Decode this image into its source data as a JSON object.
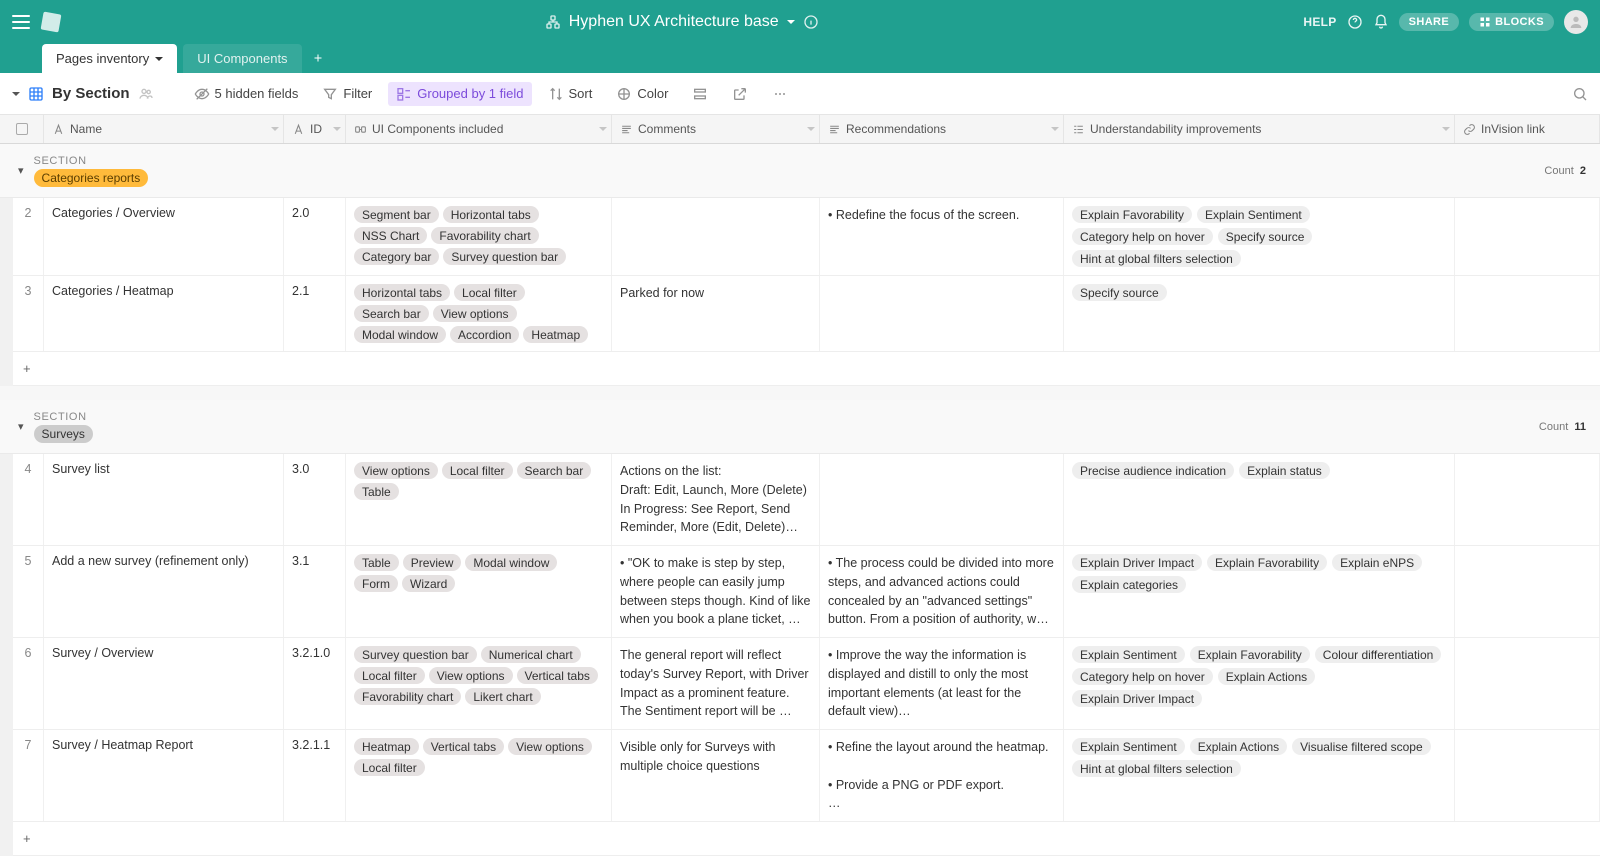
{
  "header": {
    "title": "Hyphen UX Architecture base",
    "help": "HELP",
    "share": "SHARE",
    "blocks": "BLOCKS"
  },
  "tabs": [
    {
      "label": "Pages inventory",
      "active": true
    },
    {
      "label": "UI Components",
      "active": false
    }
  ],
  "view": {
    "name": "By Section",
    "hidden_fields": "5 hidden fields",
    "filter": "Filter",
    "grouped": "Grouped by 1 field",
    "sort": "Sort",
    "color": "Color"
  },
  "columns": {
    "name": "Name",
    "id": "ID",
    "ui_components": "UI Components included",
    "comments": "Comments",
    "recommendations": "Recommendations",
    "understandability": "Understandability improvements",
    "invision": "InVision link"
  },
  "groups": [
    {
      "section_label": "SECTION",
      "name": "Categories reports",
      "pill_class": "pill-orange",
      "count_label": "Count",
      "count": "2",
      "rows": [
        {
          "num": "2",
          "name": "Categories / Overview",
          "id": "2.0",
          "components": [
            "Segment bar",
            "Horizontal tabs",
            "NSS Chart",
            "Favorability chart",
            "Category bar",
            "Survey question bar"
          ],
          "comments": "",
          "recs": "• Redefine the focus of the screen.",
          "und": [
            "Explain Favorability",
            "Explain Sentiment",
            "Category help on hover",
            "Specify source",
            "Hint at global filters selection"
          ]
        },
        {
          "num": "3",
          "name": "Categories / Heatmap",
          "id": "2.1",
          "components": [
            "Horizontal tabs",
            "Local filter",
            "Search bar",
            "View options",
            "Modal window",
            "Accordion",
            "Heatmap"
          ],
          "comments": "Parked for now",
          "recs": "",
          "und": [
            "Specify source"
          ]
        }
      ]
    },
    {
      "section_label": "SECTION",
      "name": "Surveys",
      "pill_class": "pill-gray",
      "count_label": "Count",
      "count": "11",
      "rows": [
        {
          "num": "4",
          "name": "Survey list",
          "id": "3.0",
          "components": [
            "View options",
            "Local filter",
            "Search bar",
            "Table"
          ],
          "comments": "Actions on the list:\nDraft: Edit, Launch, More (Delete)\nIn Progress: See Report, Send Reminder, More (Edit, Delete)…",
          "recs": "",
          "und": [
            "Precise audience indication",
            "Explain status"
          ]
        },
        {
          "num": "5",
          "name": "Add a new survey (refinement only)",
          "id": "3.1",
          "components": [
            "Table",
            "Preview",
            "Modal window",
            "Form",
            "Wizard"
          ],
          "comments": "• \"OK to make is step by step, where people can easily jump between steps though. Kind of like when you book a plane ticket, …",
          "recs": "• The process could be divided into more steps, and advanced actions could concealed by an \"advanced settings\" button. From a position of authority, w…",
          "und": [
            "Explain Driver Impact",
            "Explain Favorability",
            "Explain eNPS",
            "Explain categories"
          ]
        },
        {
          "num": "6",
          "name": "Survey / Overview",
          "id": "3.2.1.0",
          "components": [
            "Survey question bar",
            "Numerical chart",
            "Local filter",
            "View options",
            "Vertical tabs",
            "Favorability chart",
            "Likert chart"
          ],
          "comments": "The general report will reflect today's Survey Report, with Driver Impact as a prominent feature. The Sentiment report will be …",
          "recs": "• Improve the way the information is displayed and distill to only the most important elements (at least for the default view)…",
          "und": [
            "Explain Sentiment",
            "Explain Favorability",
            "Colour differentiation",
            "Category help on hover",
            "Explain Actions",
            "Explain Driver Impact"
          ]
        },
        {
          "num": "7",
          "name": "Survey / Heatmap Report",
          "id": "3.2.1.1",
          "components": [
            "Heatmap",
            "Vertical tabs",
            "View options",
            "Local filter"
          ],
          "comments": "Visible only for Surveys with multiple choice questions",
          "recs": "• Refine the layout around the heatmap.\n\n• Provide a PNG or PDF export.\n…",
          "und": [
            "Explain Sentiment",
            "Explain Actions",
            "Visualise filtered scope",
            "Hint at global filters selection"
          ]
        }
      ]
    }
  ],
  "plus": "+"
}
